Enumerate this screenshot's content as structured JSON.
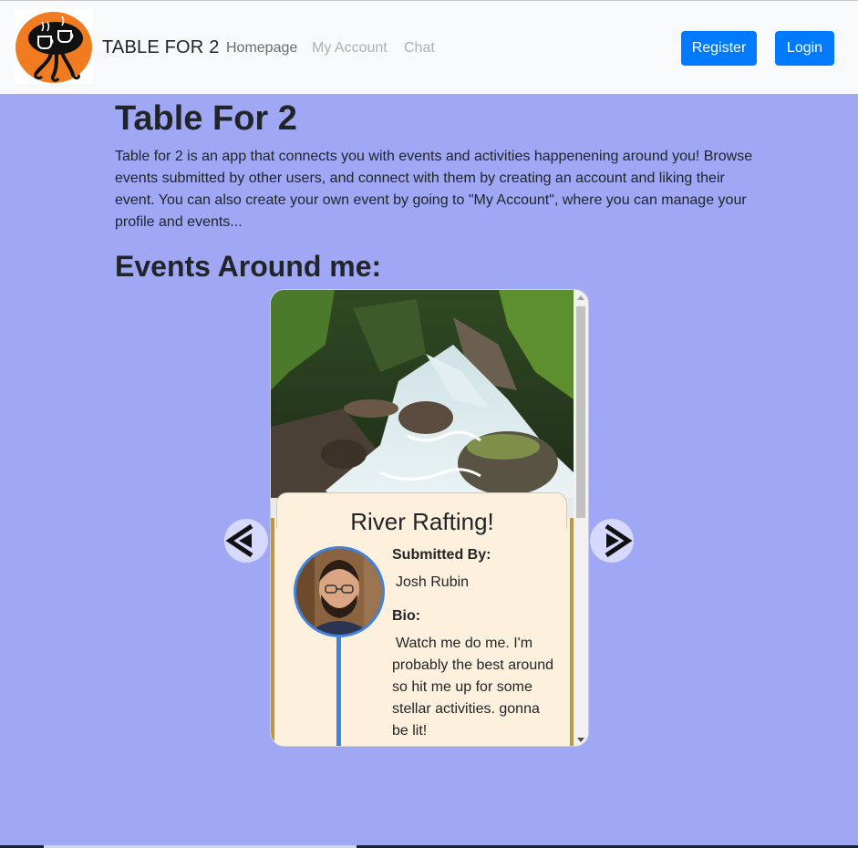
{
  "navbar": {
    "brand": "TABLE FOR 2",
    "links": [
      "Homepage",
      "My Account",
      "Chat"
    ],
    "register_label": "Register",
    "login_label": "Login",
    "logo_icon": "coffee-table-logo-icon"
  },
  "main": {
    "title": "Table For 2",
    "intro": "Table for 2 is an app that connects you with events and activities happenening around you! Browse events submitted by other users, and connect with them by creating an account and liking their event. You can also create your own event by going to \"My Account\", where you can manage your profile and events...",
    "events_heading": "Events Around me:"
  },
  "carousel": {
    "prev_icon": "chevron-left-icon",
    "next_icon": "chevron-right-icon",
    "card": {
      "title": "River Rafting!",
      "submitted_by_label": "Submitted By:",
      "submitted_by": "Josh Rubin",
      "bio_label": "Bio:",
      "bio": "Watch me do me. I'm probably the best around so hit me up for some stellar activities. gonna be lit!"
    }
  },
  "colors": {
    "background": "#a0a8f6",
    "navbar": "#f8f9fa",
    "primary_button": "#007bff",
    "card_body": "#fdf1de",
    "card_border": "#b99649",
    "avatar_ring": "#3f82e0"
  }
}
